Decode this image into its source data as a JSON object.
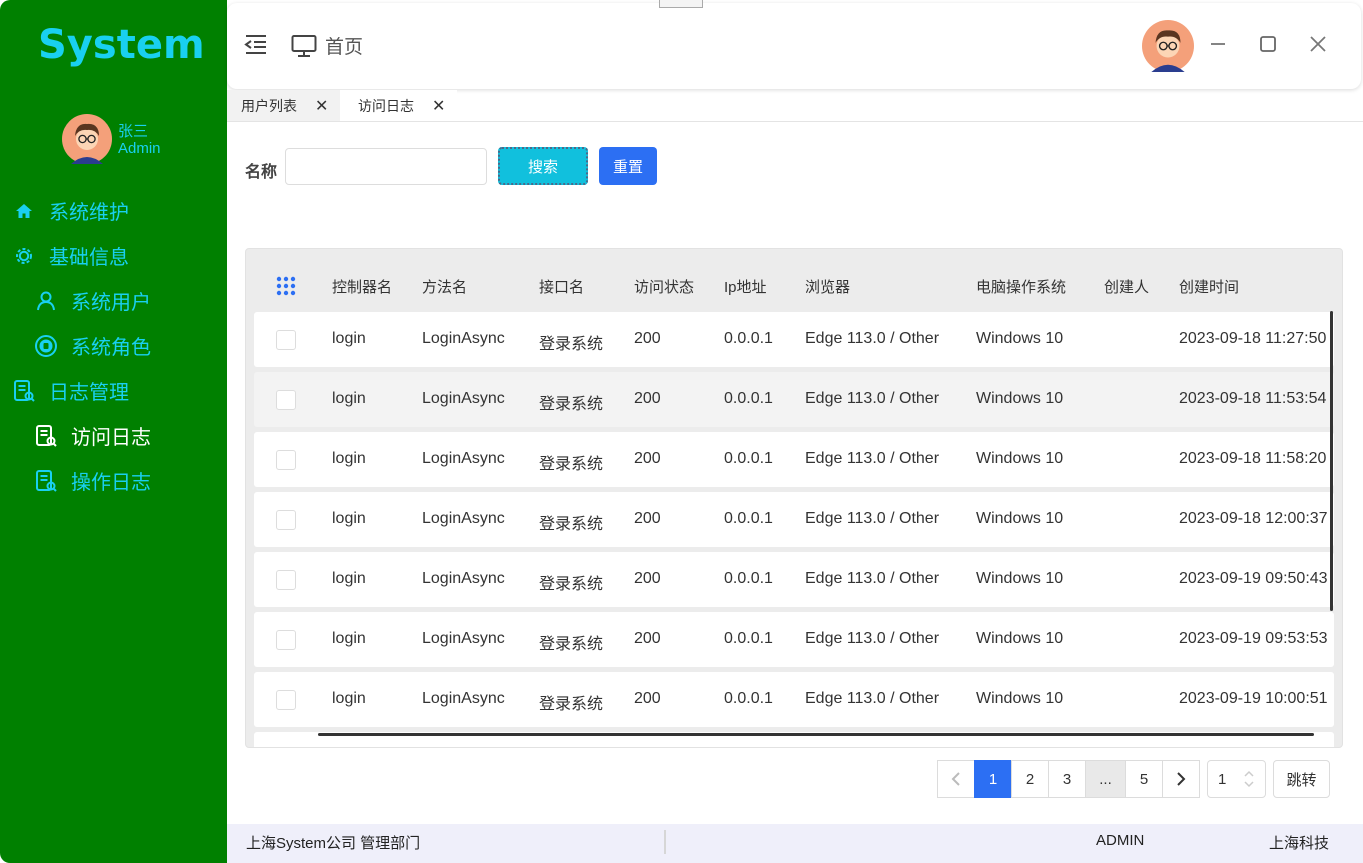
{
  "colors": {
    "sidebar_bg": "#008000",
    "accent_cyan": "#19d0f0",
    "primary_blue": "#2c6ff3",
    "search_btn": "#11c0dd"
  },
  "sidebar": {
    "logo": "System",
    "user": {
      "name": "张三",
      "role": "Admin"
    },
    "menu": [
      {
        "label": "系统维护",
        "icon": "home-icon"
      },
      {
        "label": "基础信息",
        "icon": "gear-icon"
      },
      {
        "label": "系统用户",
        "icon": "user-icon"
      },
      {
        "label": "系统角色",
        "icon": "role-badge-icon"
      },
      {
        "label": "日志管理",
        "icon": "log-doc-icon"
      },
      {
        "label": "访问日志",
        "icon": "log-search-icon",
        "active": true
      },
      {
        "label": "操作日志",
        "icon": "log-search-icon"
      }
    ]
  },
  "header": {
    "home_label": "首页"
  },
  "tabs": [
    {
      "label": "用户列表",
      "active": false
    },
    {
      "label": "访问日志",
      "active": true
    }
  ],
  "search": {
    "label": "名称",
    "value": "",
    "search_button": "搜索",
    "reset_button": "重置"
  },
  "table": {
    "columns": [
      "控制器名",
      "方法名",
      "接口名",
      "访问状态",
      "Ip地址",
      "浏览器",
      "电脑操作系统",
      "创建人",
      "创建时间"
    ],
    "rows": [
      {
        "controller": "login",
        "method": "LoginAsync",
        "api": "登录系统",
        "status": "200",
        "ip": "0.0.0.1",
        "browser": "Edge 113.0 / Other",
        "os": "Windows 10",
        "creator": "",
        "created": "2023-09-18 11:27:50"
      },
      {
        "controller": "login",
        "method": "LoginAsync",
        "api": "登录系统",
        "status": "200",
        "ip": "0.0.0.1",
        "browser": "Edge 113.0 / Other",
        "os": "Windows 10",
        "creator": "",
        "created": "2023-09-18 11:53:54"
      },
      {
        "controller": "login",
        "method": "LoginAsync",
        "api": "登录系统",
        "status": "200",
        "ip": "0.0.0.1",
        "browser": "Edge 113.0 / Other",
        "os": "Windows 10",
        "creator": "",
        "created": "2023-09-18 11:58:20"
      },
      {
        "controller": "login",
        "method": "LoginAsync",
        "api": "登录系统",
        "status": "200",
        "ip": "0.0.0.1",
        "browser": "Edge 113.0 / Other",
        "os": "Windows 10",
        "creator": "",
        "created": "2023-09-18 12:00:37"
      },
      {
        "controller": "login",
        "method": "LoginAsync",
        "api": "登录系统",
        "status": "200",
        "ip": "0.0.0.1",
        "browser": "Edge 113.0 / Other",
        "os": "Windows 10",
        "creator": "",
        "created": "2023-09-19 09:50:43"
      },
      {
        "controller": "login",
        "method": "LoginAsync",
        "api": "登录系统",
        "status": "200",
        "ip": "0.0.0.1",
        "browser": "Edge 113.0 / Other",
        "os": "Windows 10",
        "creator": "",
        "created": "2023-09-19 09:53:53"
      },
      {
        "controller": "login",
        "method": "LoginAsync",
        "api": "登录系统",
        "status": "200",
        "ip": "0.0.0.1",
        "browser": "Edge 113.0 / Other",
        "os": "Windows 10",
        "creator": "",
        "created": "2023-09-19 10:00:51"
      }
    ]
  },
  "pagination": {
    "pages": [
      "1",
      "2",
      "3",
      "...",
      "5"
    ],
    "current": "1",
    "jump_value": "1",
    "jump_label": "跳转"
  },
  "footer": {
    "company": "上海System公司 管理部门",
    "user": "ADMIN",
    "brand": "上海科技"
  }
}
